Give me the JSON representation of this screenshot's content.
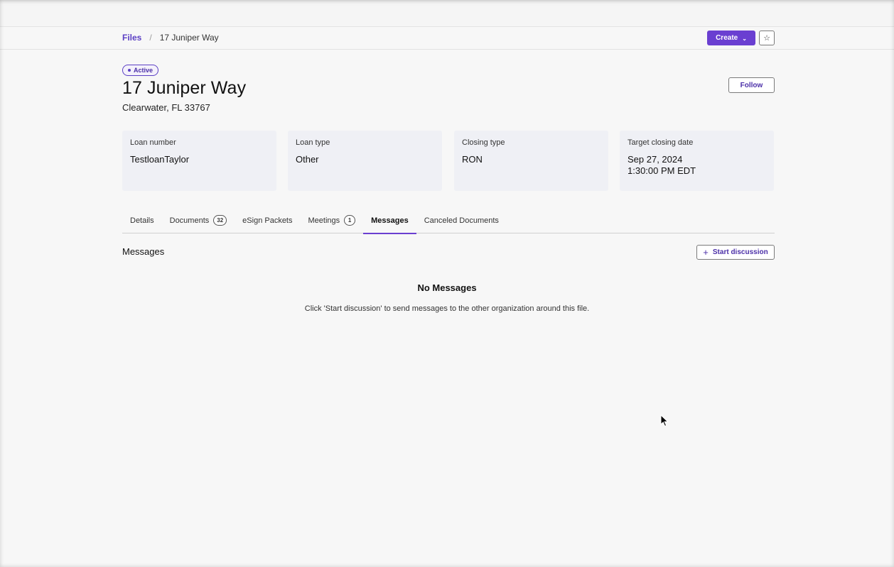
{
  "breadcrumb": {
    "root": "Files",
    "separator": "/",
    "current": "17 Juniper Way"
  },
  "header": {
    "create_label": "Create",
    "status": "Active",
    "title": "17 Juniper Way",
    "subtitle": "Clearwater, FL 33767",
    "follow_label": "Follow"
  },
  "cards": [
    {
      "label": "Loan number",
      "value": "TestloanTaylor"
    },
    {
      "label": "Loan type",
      "value": "Other"
    },
    {
      "label": "Closing type",
      "value": "RON"
    },
    {
      "label": "Target closing date",
      "value": "Sep 27, 2024",
      "value2": "1:30:00 PM EDT"
    }
  ],
  "tabs": [
    {
      "label": "Details"
    },
    {
      "label": "Documents",
      "count": "32"
    },
    {
      "label": "eSign Packets"
    },
    {
      "label": "Meetings",
      "count": "1"
    },
    {
      "label": "Messages",
      "active": true
    },
    {
      "label": "Canceled Documents"
    }
  ],
  "messages": {
    "section_title": "Messages",
    "start_label": "Start discussion",
    "empty_title": "No Messages",
    "empty_desc": "Click 'Start discussion' to send messages to the other organization around this file."
  },
  "colors": {
    "accent": "#6a3fd1",
    "link": "#5b3fc4",
    "card_bg": "#eff0f5"
  },
  "icons": {
    "create_chevron": "chevron-down-icon",
    "star": "star-icon",
    "plus": "plus-icon",
    "cursor": "mouse-pointer-icon"
  }
}
